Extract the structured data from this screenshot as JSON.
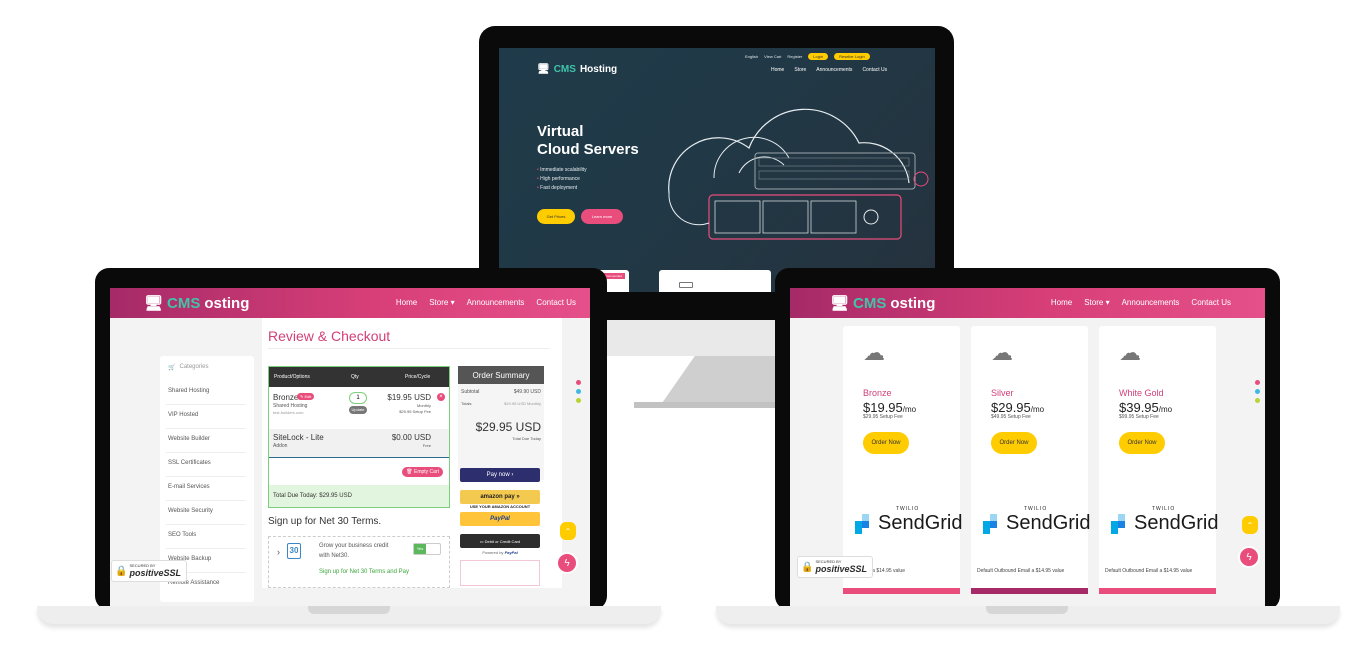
{
  "brand": {
    "cms": "CMS",
    "rest": "Hosting",
    "rest_partial": "osting"
  },
  "monitor": {
    "top_links": [
      "English",
      "View Cart",
      "Register"
    ],
    "top_pills": [
      "Login",
      "Reseller Login"
    ],
    "nav": [
      "Home",
      "Store",
      "Announcements",
      "Contact Us"
    ],
    "hero_title_1": "Virtual",
    "hero_title_2": "Cloud Servers",
    "bullets": [
      "Immediate scalability",
      "High performance",
      "Fast deployment"
    ],
    "btn_primary": "Get Prices",
    "btn_secondary": "Learn more",
    "card_badge": "Recommended"
  },
  "left_laptop": {
    "nav": [
      "Home",
      "Store",
      "Announcements",
      "Contact Us"
    ],
    "sidebar": {
      "header": "Categories",
      "items": [
        "Shared Hosting",
        "VIP Hosted",
        "Website Builder",
        "SSL Certificates",
        "E-mail Services",
        "Website Security",
        "SEO Tools",
        "Website Backup",
        "Remote Assistance"
      ]
    },
    "title": "Review & Checkout",
    "table": {
      "headers": [
        "Product/Options",
        "Qty",
        "Price/Cycle"
      ],
      "rows": [
        {
          "name": "Bronze",
          "edit": "Edit",
          "sub1": "Shared Hosting",
          "sub2": "test-builders.com",
          "qty": "1",
          "update": "Update",
          "price": "$19.95 USD",
          "cycle": "Monthly",
          "setup": "$29.95 Setup Fee"
        },
        {
          "name": "SiteLock - Lite",
          "sub1": "Addon",
          "price": "$0.00 USD",
          "cycle": "Free"
        }
      ],
      "empty_cart": "Empty Cart",
      "total_due": "Total Due Today:",
      "total_value": "$29.95 USD"
    },
    "summary": {
      "title": "Order Summary",
      "subtotal_label": "Subtotal",
      "subtotal_value": "$49.90 USD",
      "totals_label": "Totals",
      "totals_value": "$19.95 USD Monthly",
      "big_total": "$29.95 USD",
      "due_today": "Total Due Today"
    },
    "payments": {
      "pay_now": "Pay now",
      "amazon": "amazon pay",
      "amazon_sub": "USE YOUR AMAZON ACCOUNT",
      "paypal": "PayPal",
      "card": "Debit or Credit Card",
      "powered": "Powered by",
      "powered_brand": "PayPal"
    },
    "net30": {
      "title": "Sign up for Net 30 Terms.",
      "text1": "Grow your business credit",
      "text2": "with Net30.",
      "link": "Sign up for Net 30 Terms and Pay",
      "calendar": "30",
      "toggle": "Yes"
    },
    "ssl": {
      "secured": "SECURED BY",
      "brand": "positiveSSL"
    }
  },
  "right_laptop": {
    "nav": [
      "Home",
      "Store",
      "Announcements",
      "Contact Us"
    ],
    "plans": [
      {
        "name": "Bronze",
        "price": "$19.95",
        "unit": "/mo",
        "setup": "$29.95 Setup Fee",
        "button": "Order Now",
        "footer": "bound Email a $14.95 value",
        "bar": "#e84d7c"
      },
      {
        "name": "Silver",
        "price": "$29.95",
        "unit": "/mo",
        "setup": "$49.95 Setup Fee",
        "button": "Order Now",
        "footer": "Default Outbound Email a $14.95 value",
        "bar": "#a62a68"
      },
      {
        "name": "White Gold",
        "price": "$39.95",
        "unit": "/mo",
        "setup": "$99.95 Setup Fee",
        "button": "Order Now",
        "footer": "Default Outbound Email a $14.95 value",
        "bar": "#e84d7c"
      }
    ],
    "sendgrid": {
      "twilio": "TWILIO",
      "word": "SendGrid"
    },
    "ssl": {
      "secured": "SECURED BY",
      "brand": "positiveSSL"
    }
  },
  "colors": {
    "accent": "#e84d7c",
    "header_dark": "#a62a68",
    "yellow": "#ffcc00",
    "teal": "#40c4a8"
  }
}
